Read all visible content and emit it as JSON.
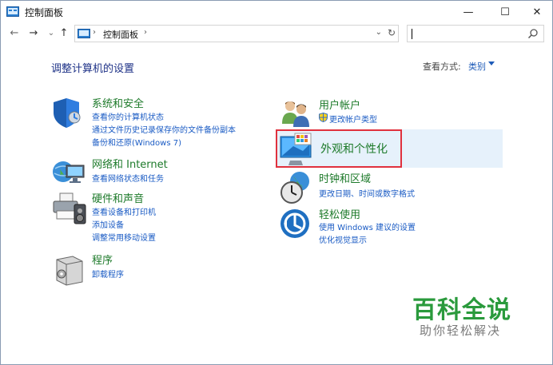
{
  "window": {
    "title": "控制面板",
    "controls": {
      "minimize": "—",
      "maximize": "☐",
      "close": "✕"
    }
  },
  "nav": {
    "back": "←",
    "forward": "→",
    "recent": "⌄",
    "up": "↑",
    "address_sep": "›",
    "address_text": "控制面板",
    "address_dropdown": "⌄",
    "refresh": "↻",
    "search_placeholder": ""
  },
  "header": {
    "page_title": "调整计算机的设置",
    "view_label": "查看方式:",
    "view_value": "类别"
  },
  "categories_left": [
    {
      "title": "系统和安全",
      "icon": "shield-icon",
      "links": [
        "查看你的计算机状态",
        "通过文件历史记录保存你的文件备份副本",
        "备份和还原(Windows 7)"
      ]
    },
    {
      "title": "网络和 Internet",
      "icon": "network-globe-icon",
      "links": [
        "查看网络状态和任务"
      ]
    },
    {
      "title": "硬件和声音",
      "icon": "printer-speaker-icon",
      "links": [
        "查看设备和打印机",
        "添加设备",
        "调整常用移动设置"
      ]
    },
    {
      "title": "程序",
      "icon": "program-icon",
      "links": [
        "卸载程序"
      ]
    }
  ],
  "categories_right": [
    {
      "title": "用户帐户",
      "icon": "users-icon",
      "links": [
        "更改帐户类型"
      ]
    },
    {
      "title": "外观和个性化",
      "icon": "appearance-monitor-icon",
      "links": []
    },
    {
      "title": "时钟和区域",
      "icon": "clock-globe-icon",
      "links": [
        "更改日期、时间或数字格式"
      ]
    },
    {
      "title": "轻松使用",
      "icon": "ease-of-access-icon",
      "links": [
        "使用 Windows 建议的设置",
        "优化视觉显示"
      ]
    }
  ],
  "watermark": {
    "brand": "百科全说",
    "slogan": "助你轻松解决"
  },
  "colors": {
    "category_title": "#1d7a2a",
    "link": "#1a5bc4",
    "page_title": "#1e3287",
    "highlight_border": "#e0313d",
    "highlight_bg": "#e6f1fb",
    "watermark_green": "#2a9a3c"
  }
}
